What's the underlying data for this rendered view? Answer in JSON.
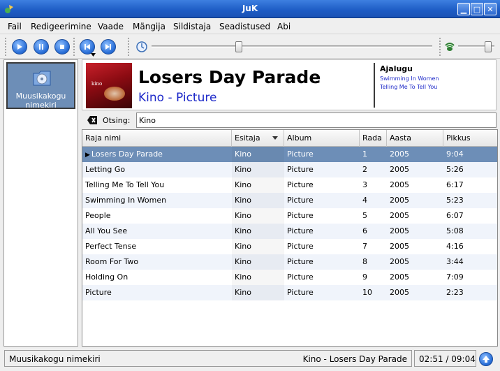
{
  "window": {
    "title": "JuK"
  },
  "menu": [
    "Fail",
    "Redigeerimine",
    "Vaade",
    "Mängija",
    "Sildistaja",
    "Seadistused",
    "Abi"
  ],
  "sidebar": {
    "playlist_label_line1": "Muusikakogu",
    "playlist_label_line2": "nimekiri"
  },
  "now_playing": {
    "title": "Losers Day Parade",
    "artist_album": "Kino - Picture",
    "history_title": "Ajalugu",
    "history_items": [
      "Swimming In Women",
      "Telling Me To Tell You"
    ],
    "cover_text": "kino"
  },
  "search": {
    "label": "Otsing:",
    "value": "Kino"
  },
  "table": {
    "columns": [
      "Raja nimi",
      "Esitaja",
      "Album",
      "Rada",
      "Aasta",
      "Pikkus"
    ],
    "rows": [
      [
        "Losers Day Parade",
        "Kino",
        "Picture",
        "1",
        "2005",
        "9:04"
      ],
      [
        "Letting Go",
        "Kino",
        "Picture",
        "2",
        "2005",
        "5:26"
      ],
      [
        "Telling Me To Tell You",
        "Kino",
        "Picture",
        "3",
        "2005",
        "6:17"
      ],
      [
        "Swimming In Women",
        "Kino",
        "Picture",
        "4",
        "2005",
        "5:23"
      ],
      [
        "People",
        "Kino",
        "Picture",
        "5",
        "2005",
        "6:07"
      ],
      [
        "All You See",
        "Kino",
        "Picture",
        "6",
        "2005",
        "5:08"
      ],
      [
        "Perfect Tense",
        "Kino",
        "Picture",
        "7",
        "2005",
        "4:16"
      ],
      [
        "Room For Two",
        "Kino",
        "Picture",
        "8",
        "2005",
        "3:44"
      ],
      [
        "Holding On",
        "Kino",
        "Picture",
        "9",
        "2005",
        "7:09"
      ],
      [
        "Picture",
        "Kino",
        "Picture",
        "10",
        "2005",
        "2:23"
      ]
    ],
    "playing_row": 0
  },
  "status": {
    "playlist": "Muusikakogu nimekiri",
    "track": "Kino - Losers Day Parade",
    "time": "02:51 / 09:04"
  },
  "player": {
    "track_position": 0.31,
    "volume": 0.82
  },
  "colors": {
    "selection": "#6d8eb7",
    "link": "#1d29c9",
    "titlebar": "#1d5bc4"
  }
}
